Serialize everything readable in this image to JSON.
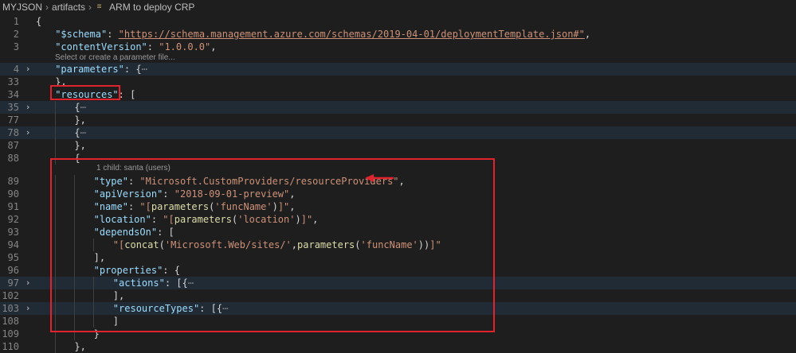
{
  "breadcrumb": {
    "items": [
      "MYJSON",
      "artifacts",
      "ARM to deploy CRP"
    ],
    "icon": "json-file-icon"
  },
  "codelens": {
    "params": "Select or create a parameter file...",
    "child": "1 child: santa (users)"
  },
  "lines": [
    {
      "n": "1",
      "fold": "",
      "code": [
        [
          "p",
          "{"
        ]
      ]
    },
    {
      "n": "2",
      "fold": "",
      "code": [
        [
          "k",
          "\"$schema\""
        ],
        [
          "p",
          ": "
        ],
        [
          "u",
          "\"https://schema.management.azure.com/schemas/2019-04-01/deploymentTemplate.json#\""
        ],
        [
          "p",
          ","
        ]
      ]
    },
    {
      "n": "3",
      "fold": "",
      "code": [
        [
          "k",
          "\"contentVersion\""
        ],
        [
          "p",
          ": "
        ],
        [
          "s",
          "\"1.0.0.0\""
        ],
        [
          "p",
          ","
        ]
      ]
    },
    {
      "n": "4",
      "fold": ">",
      "code": [
        [
          "k",
          "\"parameters\""
        ],
        [
          "p",
          ": {"
        ],
        [
          "dots",
          "⋯"
        ]
      ]
    },
    {
      "n": "33",
      "fold": "",
      "code": [
        [
          "p",
          "},"
        ]
      ]
    },
    {
      "n": "34",
      "fold": "",
      "code": [
        [
          "k",
          "\"resources\""
        ],
        [
          "p",
          ": ["
        ]
      ]
    },
    {
      "n": "35",
      "fold": ">",
      "code": [
        [
          "p",
          "{"
        ],
        [
          "dots",
          "⋯"
        ]
      ]
    },
    {
      "n": "77",
      "fold": "",
      "code": [
        [
          "p",
          "},"
        ]
      ]
    },
    {
      "n": "78",
      "fold": ">",
      "code": [
        [
          "p",
          "{"
        ],
        [
          "dots",
          "⋯"
        ]
      ]
    },
    {
      "n": "87",
      "fold": "",
      "code": [
        [
          "p",
          "},"
        ]
      ]
    },
    {
      "n": "88",
      "fold": "",
      "code": [
        [
          "p",
          "{"
        ]
      ]
    },
    {
      "n": "89",
      "fold": "",
      "code": [
        [
          "k",
          "\"type\""
        ],
        [
          "p",
          ": "
        ],
        [
          "s",
          "\"Microsoft.CustomProviders/resourceProviders\""
        ],
        [
          "p",
          ","
        ]
      ]
    },
    {
      "n": "90",
      "fold": "",
      "code": [
        [
          "k",
          "\"apiVersion\""
        ],
        [
          "p",
          ": "
        ],
        [
          "s",
          "\"2018-09-01-preview\""
        ],
        [
          "p",
          ","
        ]
      ]
    },
    {
      "n": "91",
      "fold": "",
      "code": [
        [
          "k",
          "\"name\""
        ],
        [
          "p",
          ": "
        ],
        [
          "s",
          "\"["
        ],
        [
          "f",
          "parameters"
        ],
        [
          "p",
          "("
        ],
        [
          "sq",
          "'funcName'"
        ],
        [
          "p",
          ")"
        ],
        [
          "s",
          "]\""
        ],
        [
          "p",
          ","
        ]
      ]
    },
    {
      "n": "92",
      "fold": "",
      "code": [
        [
          "k",
          "\"location\""
        ],
        [
          "p",
          ": "
        ],
        [
          "s",
          "\"["
        ],
        [
          "f",
          "parameters"
        ],
        [
          "p",
          "("
        ],
        [
          "sq",
          "'location'"
        ],
        [
          "p",
          ")"
        ],
        [
          "s",
          "]\""
        ],
        [
          "p",
          ","
        ]
      ]
    },
    {
      "n": "93",
      "fold": "",
      "code": [
        [
          "k",
          "\"dependsOn\""
        ],
        [
          "p",
          ": ["
        ]
      ]
    },
    {
      "n": "94",
      "fold": "",
      "code": [
        [
          "s",
          "\"["
        ],
        [
          "f",
          "concat"
        ],
        [
          "p",
          "("
        ],
        [
          "sq",
          "'Microsoft.Web/sites/'"
        ],
        [
          "p",
          ","
        ],
        [
          "f",
          "parameters"
        ],
        [
          "p",
          "("
        ],
        [
          "sq",
          "'funcName'"
        ],
        [
          "p",
          "))"
        ],
        [
          "s",
          "]\""
        ]
      ]
    },
    {
      "n": "95",
      "fold": "",
      "code": [
        [
          "p",
          "],"
        ]
      ]
    },
    {
      "n": "96",
      "fold": "",
      "code": [
        [
          "k",
          "\"properties\""
        ],
        [
          "p",
          ": {"
        ]
      ]
    },
    {
      "n": "97",
      "fold": ">",
      "code": [
        [
          "k",
          "\"actions\""
        ],
        [
          "p",
          ": [{"
        ],
        [
          "dots",
          "⋯"
        ]
      ]
    },
    {
      "n": "102",
      "fold": "",
      "code": [
        [
          "p",
          "],"
        ]
      ]
    },
    {
      "n": "103",
      "fold": ">",
      "code": [
        [
          "k",
          "\"resourceTypes\""
        ],
        [
          "p",
          ": [{"
        ],
        [
          "dots",
          "⋯"
        ]
      ]
    },
    {
      "n": "108",
      "fold": "",
      "code": [
        [
          "p",
          "]"
        ]
      ]
    },
    {
      "n": "109",
      "fold": "",
      "code": [
        [
          "p",
          "}"
        ]
      ]
    },
    {
      "n": "110",
      "fold": "",
      "code": [
        [
          "p",
          "},"
        ]
      ]
    }
  ],
  "colors": {
    "annotation": "#e0232d",
    "folded_line_bg": "#212b36"
  }
}
